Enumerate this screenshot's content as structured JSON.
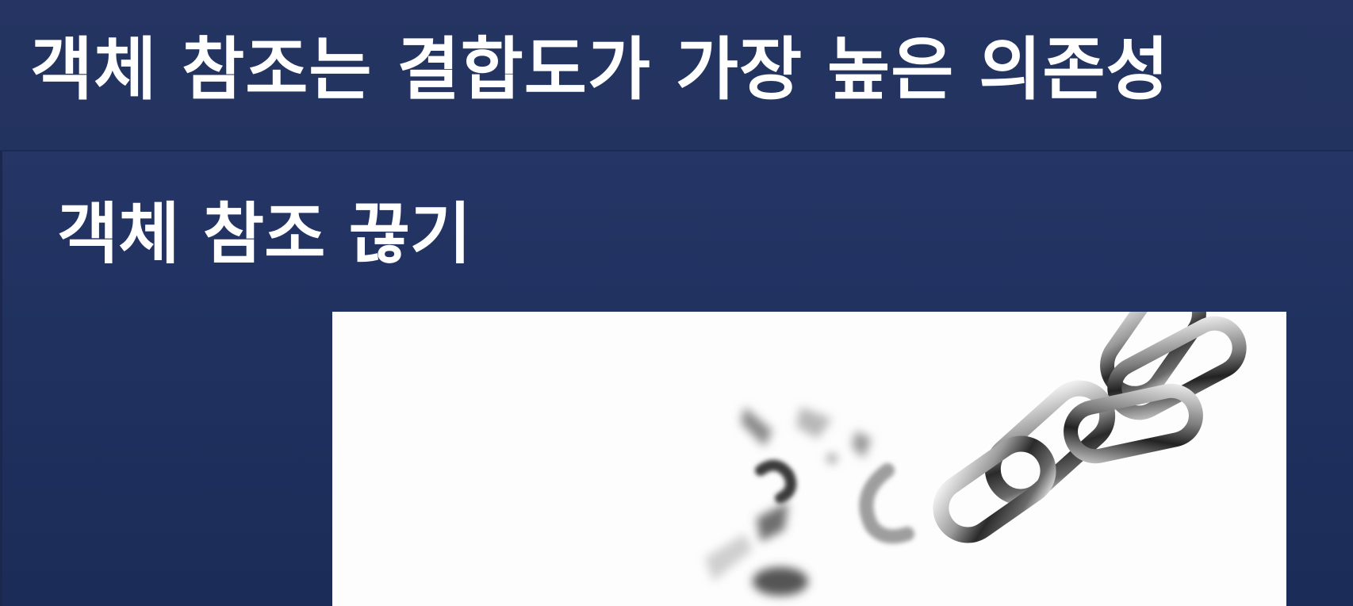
{
  "slide": {
    "title": "객체 참조는 결합도가 가장 높은 의존성",
    "heading": "객체 참조 끊기",
    "image": {
      "subject": "broken-chain-image",
      "background": "#fdfdfd"
    }
  },
  "colors": {
    "slide_background": "#22325e",
    "title_bar": "#253462",
    "text": "#ffffff",
    "chain_dark": "#2e2e2e",
    "chain_highlight": "#e8e8e8"
  }
}
